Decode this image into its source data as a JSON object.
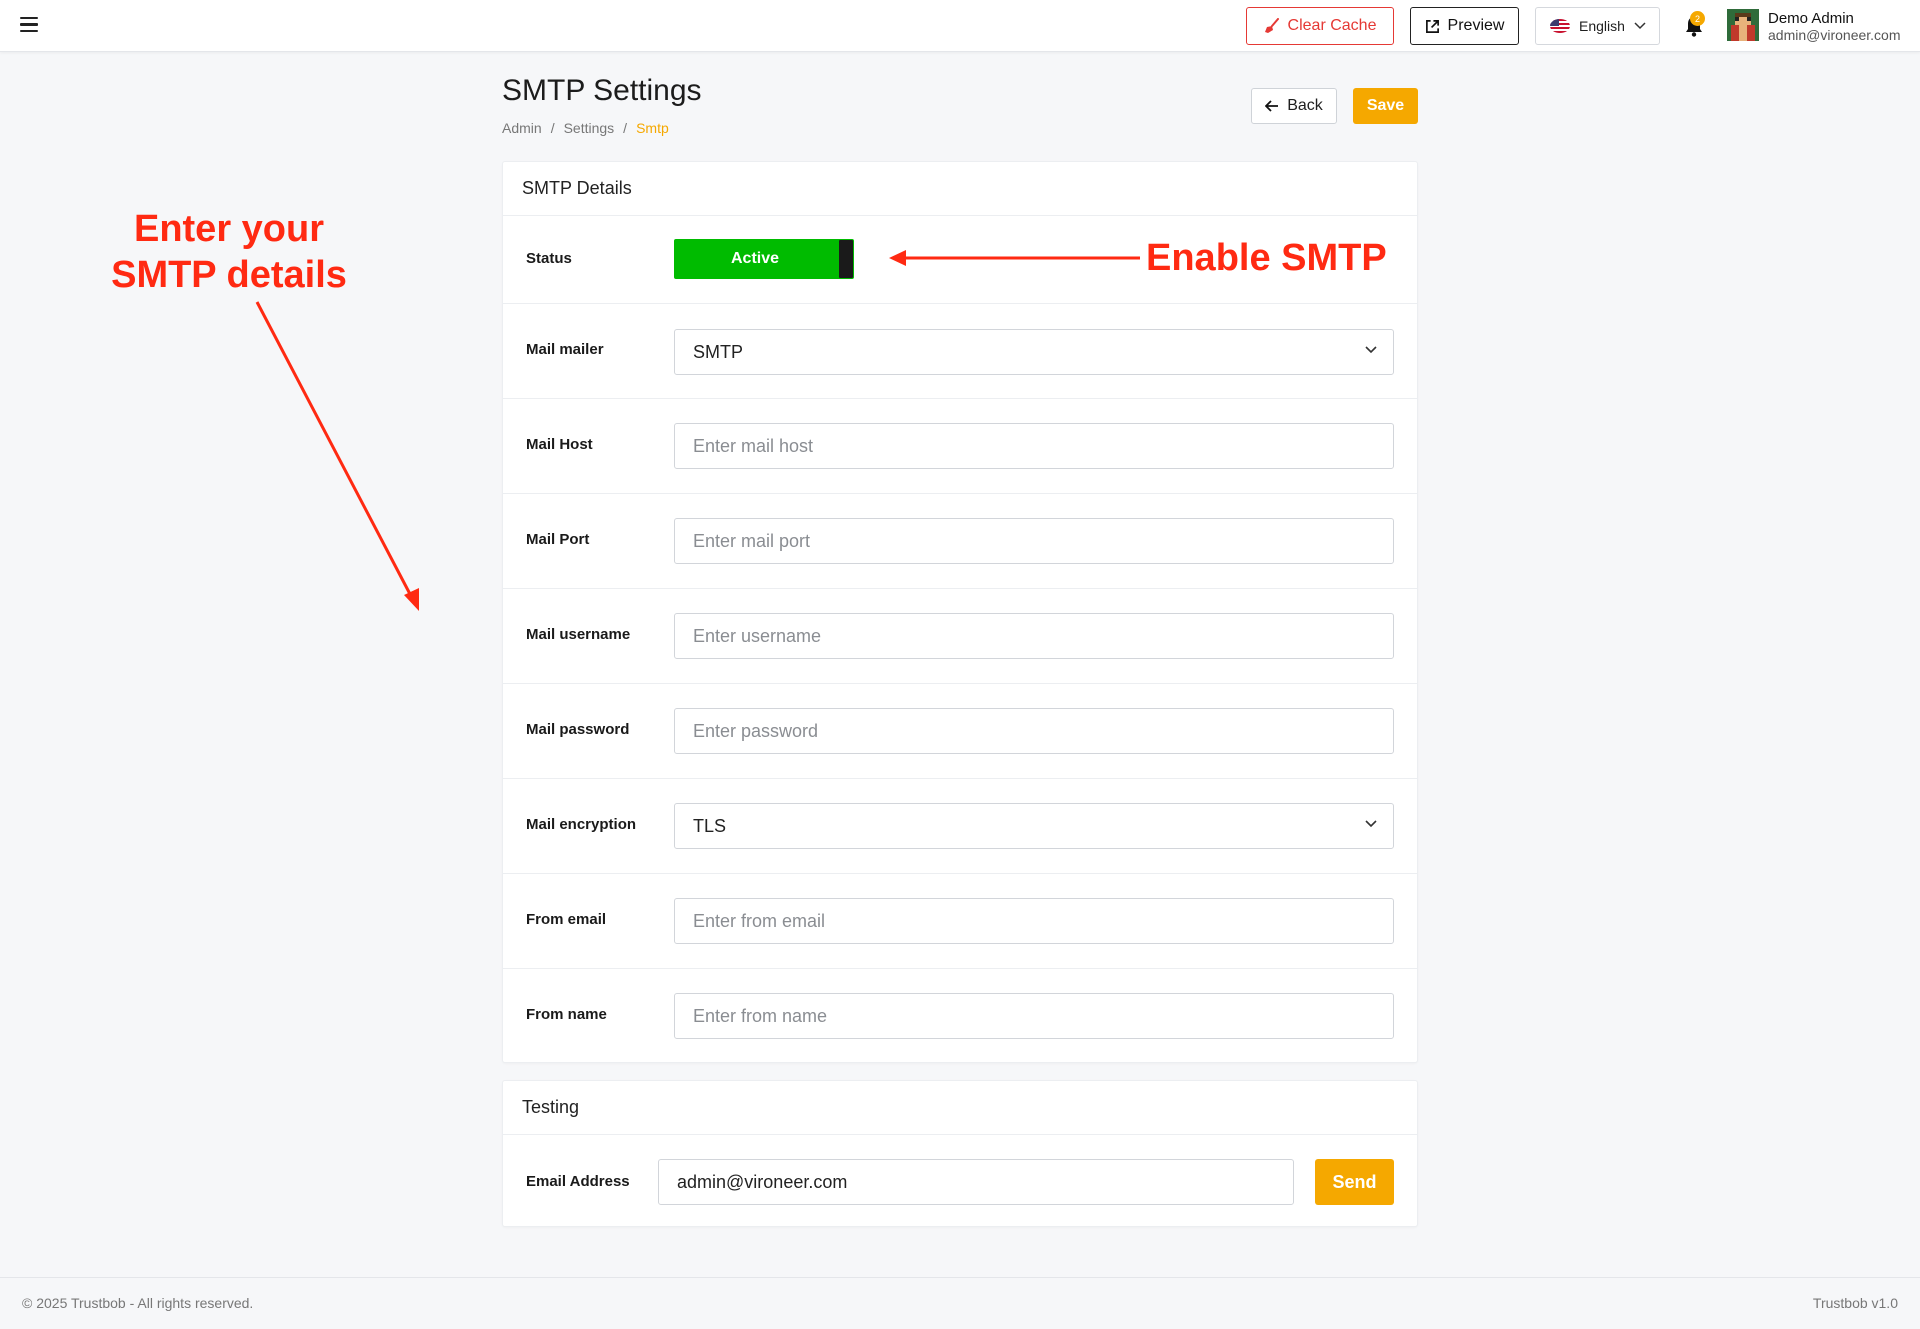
{
  "topbar": {
    "clear_cache_label": "Clear Cache",
    "preview_label": "Preview",
    "language": "English",
    "notification_count": "2",
    "user_name": "Demo Admin",
    "user_email": "admin@vironeer.com"
  },
  "page": {
    "title": "SMTP Settings",
    "breadcrumb": [
      "Admin",
      "Settings",
      "Smtp"
    ],
    "back_label": "Back",
    "save_label": "Save"
  },
  "smtp_card": {
    "header": "SMTP Details",
    "status_label": "Status",
    "status_value": "Active",
    "mail_mailer": {
      "label": "Mail mailer",
      "value": "SMTP"
    },
    "mail_host": {
      "label": "Mail Host",
      "placeholder": "Enter mail host"
    },
    "mail_port": {
      "label": "Mail Port",
      "placeholder": "Enter mail port"
    },
    "mail_username": {
      "label": "Mail username",
      "placeholder": "Enter username"
    },
    "mail_password": {
      "label": "Mail password",
      "placeholder": "Enter password"
    },
    "mail_encryption": {
      "label": "Mail encryption",
      "value": "TLS"
    },
    "from_email": {
      "label": "From email",
      "placeholder": "Enter from email"
    },
    "from_name": {
      "label": "From name",
      "placeholder": "Enter from name"
    }
  },
  "testing_card": {
    "header": "Testing",
    "email_label": "Email Address",
    "email_value": "admin@vironeer.com",
    "send_label": "Send"
  },
  "annotations": {
    "left_line1": "Enter your",
    "left_line2": "SMTP details",
    "right": "Enable SMTP"
  },
  "footer": {
    "copyright": "© 2025 Trustbob - All rights reserved.",
    "version": "Trustbob v1.0"
  },
  "colors": {
    "accent": "#f5a800",
    "danger": "#e53935",
    "toggle_on": "#00bb00",
    "annotation": "#ff2a12"
  }
}
